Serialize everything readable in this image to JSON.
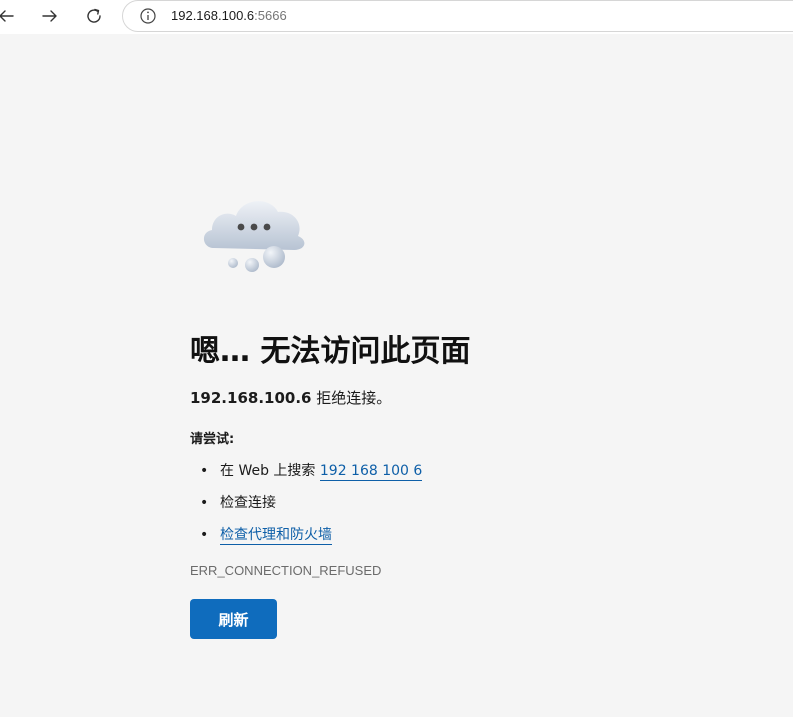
{
  "browser": {
    "address_bar": {
      "host": "192.168.100.6",
      "port": ":5666"
    },
    "icons": {
      "back": "back-arrow-icon",
      "forward": "forward-arrow-icon",
      "refresh": "refresh-icon",
      "site_info": "info-icon"
    }
  },
  "error_page": {
    "headline": "嗯… 无法访问此页面",
    "subtitle_ip": "192.168.100.6",
    "subtitle_text": " 拒绝连接。",
    "try_label": "请尝试:",
    "suggestions": [
      {
        "prefix": "在 Web 上搜索 ",
        "link": "192 168 100 6"
      },
      {
        "text": "检查连接"
      },
      {
        "link": "检查代理和防火墙"
      }
    ],
    "error_code": "ERR_CONNECTION_REFUSED",
    "refresh_button": "刷新",
    "illustration": "cloud-error-icon"
  },
  "colors": {
    "page_background": "#f5f5f5",
    "link": "#0e5fa8",
    "button": "#0f6cbd"
  }
}
